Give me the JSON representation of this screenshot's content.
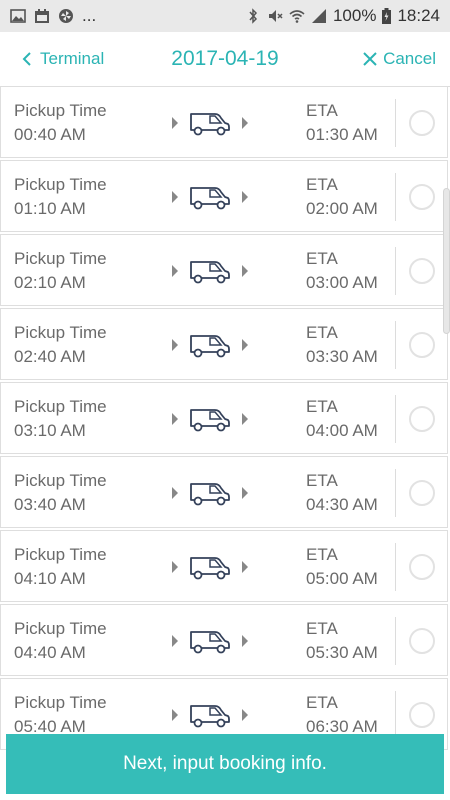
{
  "status_bar": {
    "icons_left": [
      "image-icon",
      "calendar-icon",
      "pinwheel-icon"
    ],
    "more": "...",
    "icons_right": [
      "bluetooth-icon",
      "mute-icon",
      "wifi-icon",
      "signal-icon"
    ],
    "battery": "100%",
    "time": "18:24"
  },
  "header": {
    "back_label": "Terminal",
    "title": "2017-04-19",
    "cancel_label": "Cancel"
  },
  "colors": {
    "accent": "#2bb4b4",
    "button": "#35bdb8",
    "text": "#6a6a6a"
  },
  "rows": [
    {
      "pickup_label": "Pickup Time",
      "pickup_time": "00:40 AM",
      "eta_label": "ETA",
      "eta_time": "01:30 AM"
    },
    {
      "pickup_label": "Pickup Time",
      "pickup_time": "01:10 AM",
      "eta_label": "ETA",
      "eta_time": "02:00 AM"
    },
    {
      "pickup_label": "Pickup Time",
      "pickup_time": "02:10 AM",
      "eta_label": "ETA",
      "eta_time": "03:00 AM"
    },
    {
      "pickup_label": "Pickup Time",
      "pickup_time": "02:40 AM",
      "eta_label": "ETA",
      "eta_time": "03:30 AM"
    },
    {
      "pickup_label": "Pickup Time",
      "pickup_time": "03:10 AM",
      "eta_label": "ETA",
      "eta_time": "04:00 AM"
    },
    {
      "pickup_label": "Pickup Time",
      "pickup_time": "03:40 AM",
      "eta_label": "ETA",
      "eta_time": "04:30 AM"
    },
    {
      "pickup_label": "Pickup Time",
      "pickup_time": "04:10 AM",
      "eta_label": "ETA",
      "eta_time": "05:00 AM"
    },
    {
      "pickup_label": "Pickup Time",
      "pickup_time": "04:40 AM",
      "eta_label": "ETA",
      "eta_time": "05:30 AM"
    },
    {
      "pickup_label": "Pickup Time",
      "pickup_time": "05:40 AM",
      "eta_label": "ETA",
      "eta_time": "06:30 AM"
    }
  ],
  "next_button_label": "Next, input booking info."
}
